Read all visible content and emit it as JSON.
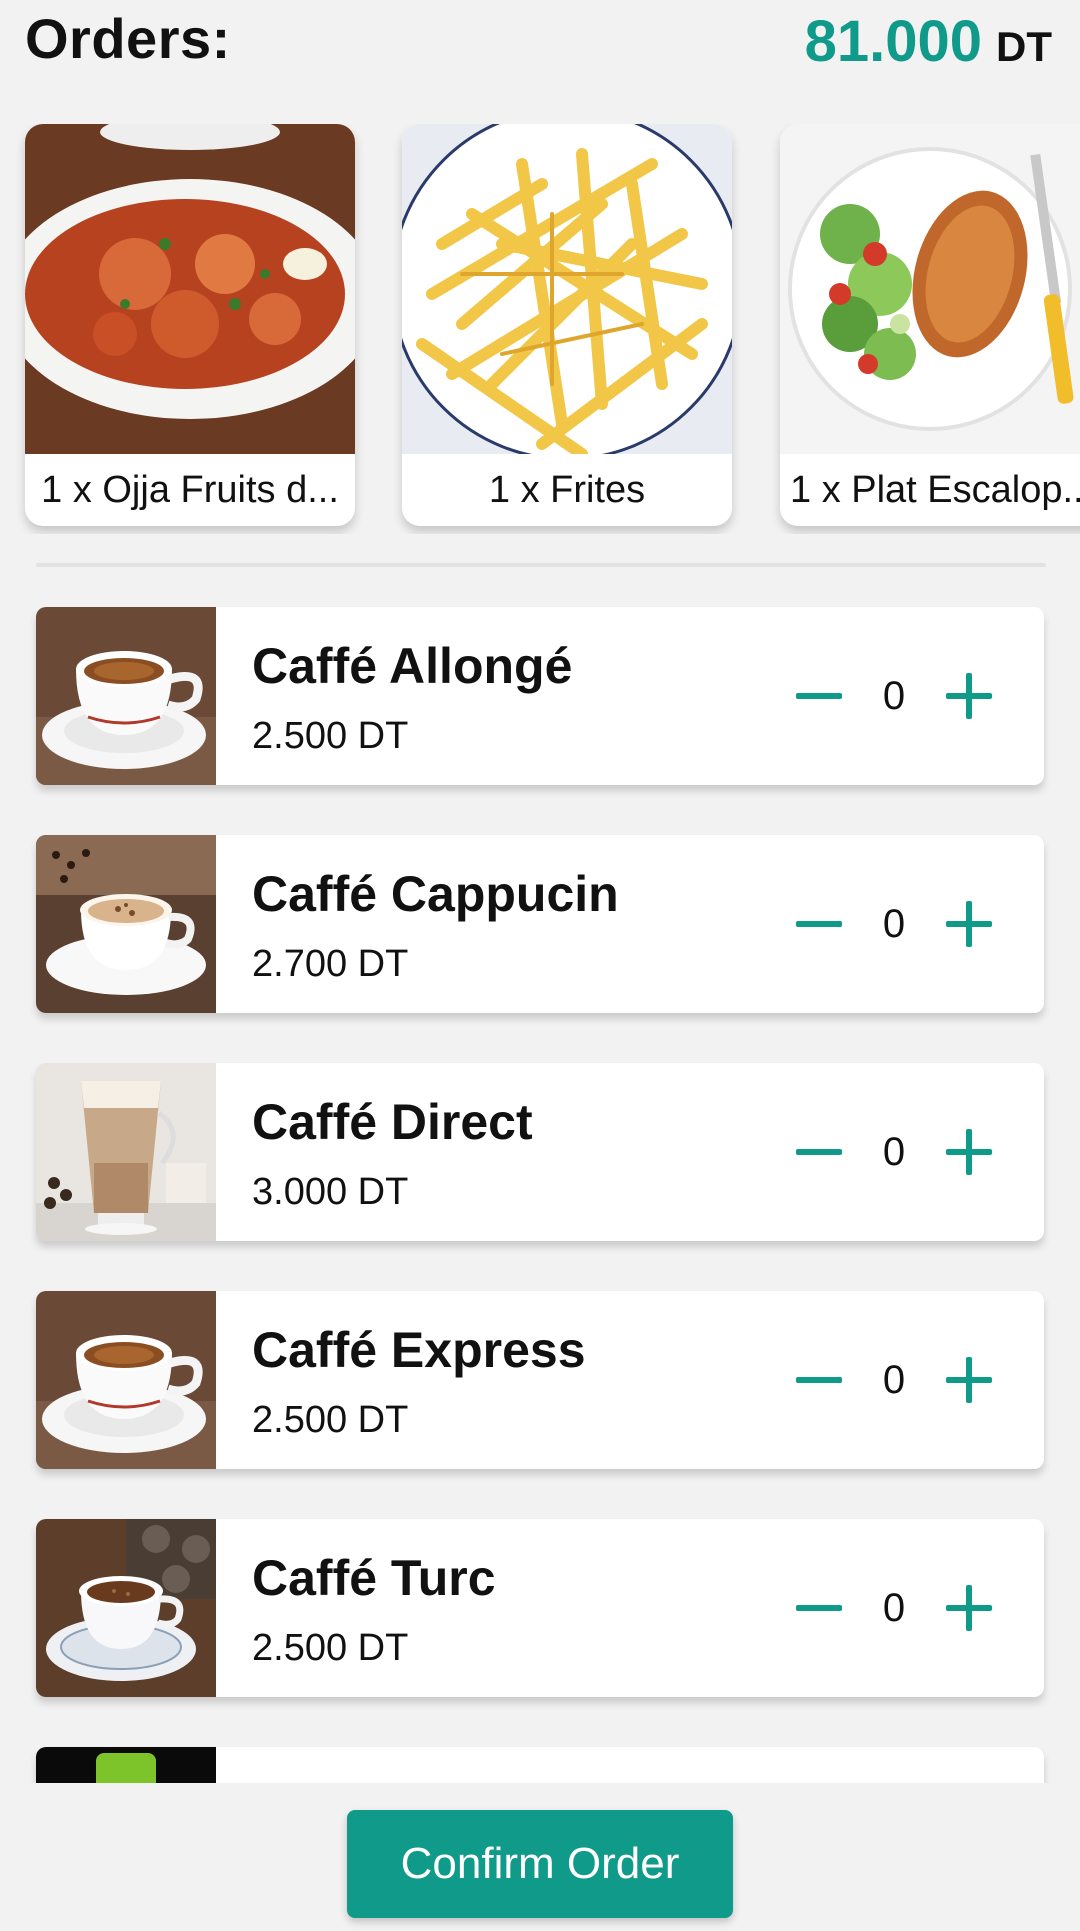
{
  "header": {
    "title": "Orders:",
    "total_amount": "81.000",
    "total_currency": "DT"
  },
  "orders": [
    {
      "label": "1 x Ojja Fruits d..."
    },
    {
      "label": "1 x Frites"
    },
    {
      "label": "1 x Plat Escalop..."
    }
  ],
  "products": [
    {
      "name": "Caffé Allongé",
      "price": "2.500 DT",
      "qty": "0"
    },
    {
      "name": "Caffé Cappucin",
      "price": "2.700 DT",
      "qty": "0"
    },
    {
      "name": "Caffé Direct",
      "price": "3.000 DT",
      "qty": "0"
    },
    {
      "name": "Caffé Express",
      "price": "2.500 DT",
      "qty": "0"
    },
    {
      "name": "Caffé Turc",
      "price": "2.500 DT",
      "qty": "0"
    }
  ],
  "footer": {
    "confirm_label": "Confirm Order"
  },
  "colors": {
    "accent": "#0f9a8a",
    "background": "#f2f2f2"
  },
  "icons": {
    "decrement": "minus-icon",
    "increment": "plus-icon"
  }
}
